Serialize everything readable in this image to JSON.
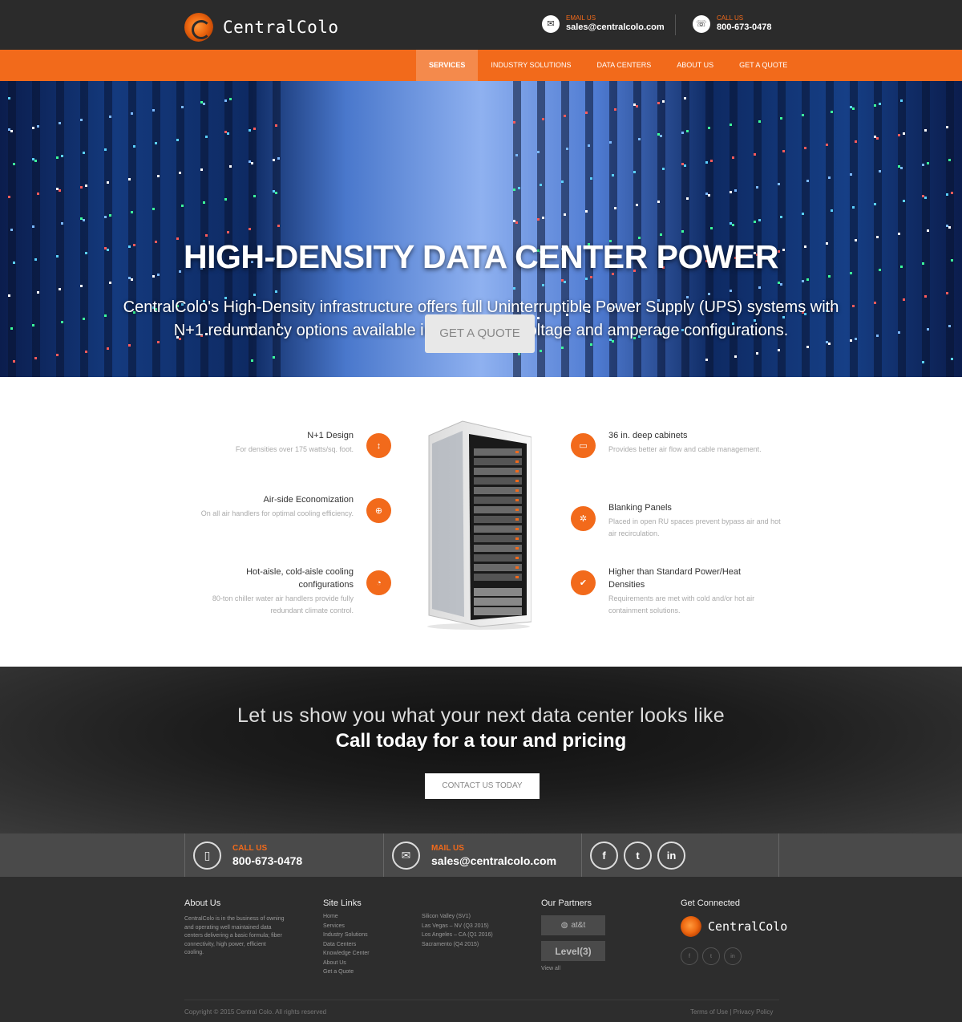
{
  "header": {
    "logo_text": "CentralColo",
    "email_label": "EMAIL US",
    "email": "sales@centralcolo.com",
    "call_label": "CALL US",
    "phone": "800-673-0478"
  },
  "nav": {
    "items": [
      {
        "label": "SERVICES",
        "active": true
      },
      {
        "label": "INDUSTRY SOLUTIONS"
      },
      {
        "label": "DATA CENTERS"
      },
      {
        "label": "ABOUT US"
      },
      {
        "label": "GET A QUOTE"
      }
    ]
  },
  "hero": {
    "title": "HIGH-DENSITY DATA CENTER POWER",
    "subtitle_line1": "CentralColo's High-Density infrastructure offers full Uninterruptible Power Supply (UPS) systems with",
    "subtitle_line2": "N+1 redundancy options available in a variety of voltage and amperage configurations.",
    "button": "GET A QUOTE"
  },
  "features": {
    "left": [
      {
        "title": "N+1 Design",
        "desc": "For densities over 175 watts/sq. foot."
      },
      {
        "title": "Air-side Economization",
        "desc": "On all air handlers for optimal cooling efficiency."
      },
      {
        "title_line1": "Hot-aisle, cold-aisle cooling",
        "title_line2": "configurations",
        "desc": "80-ton chiller water air handlers provide fully redundant climate control."
      }
    ],
    "right": [
      {
        "title": "36 in. deep cabinets",
        "desc": "Provides better air flow and cable management."
      },
      {
        "title": "Blanking Panels",
        "desc": "Placed in open RU spaces prevent bypass air and hot air recirculation."
      },
      {
        "title_line1": "Higher than Standard Power/Heat",
        "title_line2": "Densities",
        "desc": "Requirements are met with cold and/or hot air containment solutions."
      }
    ]
  },
  "cta": {
    "line1": "Let us show you what your next data center looks like",
    "line2": "Call today for a tour and pricing",
    "button": "CONTACT US TODAY"
  },
  "strip": {
    "call_label": "CALL US",
    "phone": "800-673-0478",
    "mail_label": "MAIL US",
    "email": "sales@centralcolo.com",
    "social": [
      "f",
      "t",
      "in"
    ]
  },
  "footer": {
    "about_heading": "About Us",
    "about_text": "CentralColo is in the business of owning and operating well maintained data centers delivering a basic formula; fiber connectivity, high power, efficient cooling.",
    "sitelinks_heading": "Site Links",
    "sitelinks": [
      "Home",
      "Services",
      "Industry Solutions",
      "Data Centers",
      "Knowledge Center",
      "About Us",
      "Get a Quote"
    ],
    "locations": [
      "Silicon Valley (SV1)",
      "Las Vegas – NV (Q3 2015)",
      "Los Angeles – CA (Q1 2016)",
      "Sacramento (Q4 2015)"
    ],
    "partners_heading": "Our Partners",
    "partners": [
      "at&t",
      "Level(3)"
    ],
    "view_all": "View all",
    "connected_heading": "Get Connected",
    "logo_text": "CentralColo",
    "social": [
      "f",
      "t",
      "in"
    ],
    "copyright": "Copyright © 2015 Central Colo. All rights reserved",
    "legal": "Terms of Use | Privacy Policy"
  },
  "colors": {
    "accent": "#f26a1b",
    "dark": "#2b2b2b",
    "strip": "#4a4a4a"
  }
}
